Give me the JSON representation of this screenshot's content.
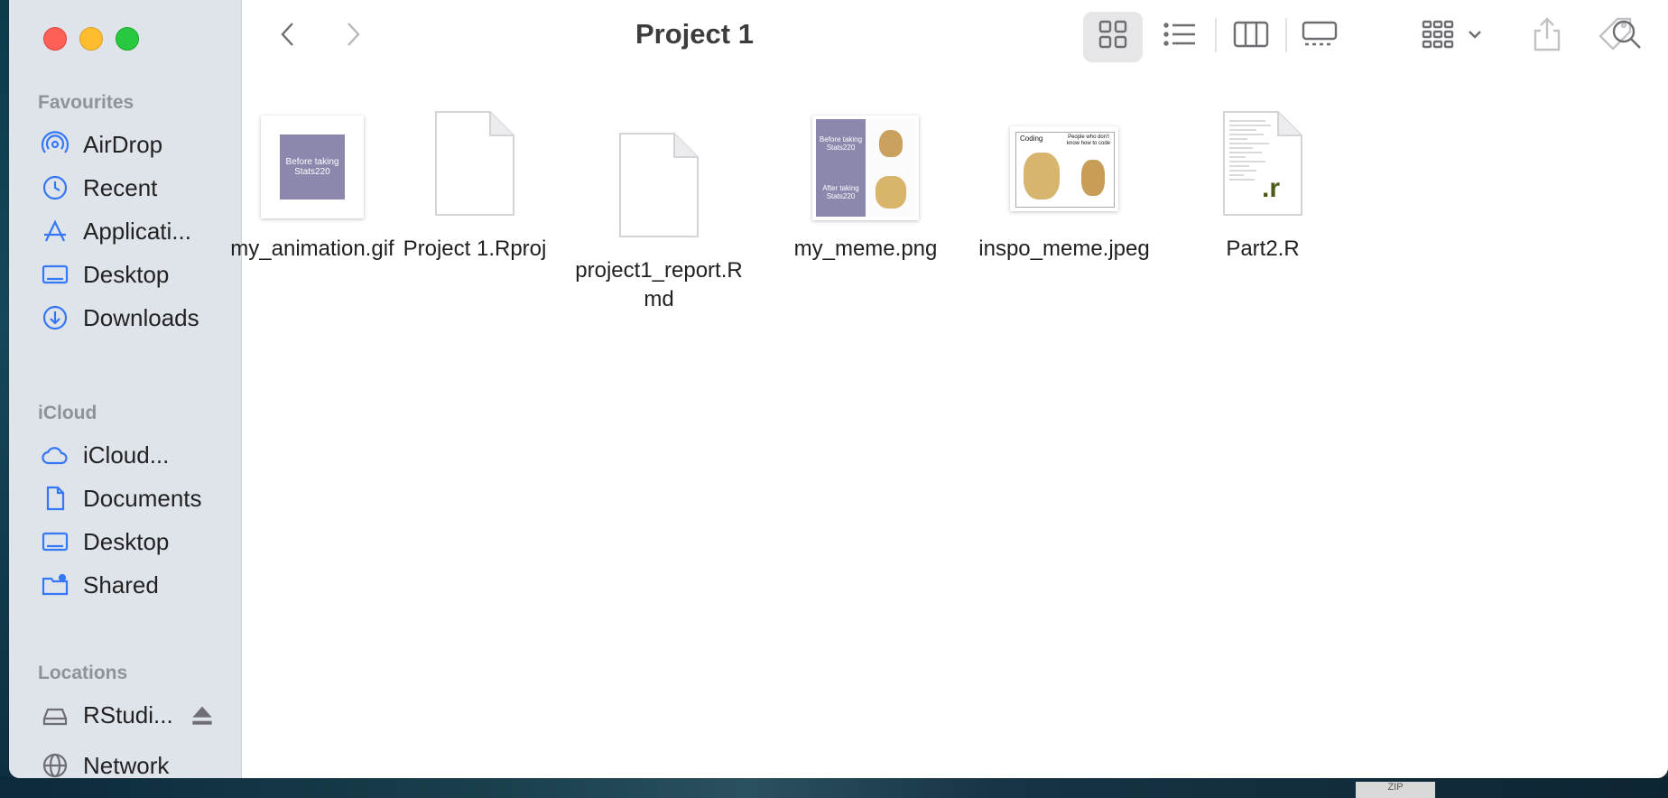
{
  "window": {
    "title": "Project 1"
  },
  "sidebar": {
    "sections": [
      {
        "title": "Favourites",
        "items": [
          {
            "label": "AirDrop",
            "icon": "airdrop-icon"
          },
          {
            "label": "Recent",
            "icon": "clock-icon"
          },
          {
            "label": "Applicati...",
            "icon": "applications-icon"
          },
          {
            "label": "Desktop",
            "icon": "desktop-icon"
          },
          {
            "label": "Downloads",
            "icon": "download-icon"
          }
        ]
      },
      {
        "title": "iCloud",
        "items": [
          {
            "label": "iCloud...",
            "icon": "cloud-icon"
          },
          {
            "label": "Documents",
            "icon": "document-icon"
          },
          {
            "label": "Desktop",
            "icon": "desktop-icon"
          },
          {
            "label": "Shared",
            "icon": "shared-folder-icon"
          }
        ]
      },
      {
        "title": "Locations",
        "items": [
          {
            "label": "RStudi...",
            "icon": "disk-icon"
          },
          {
            "label": "Network",
            "icon": "network-icon"
          }
        ]
      }
    ]
  },
  "toolbar": {
    "back": "chevron-left-icon",
    "forward": "chevron-right-icon",
    "views": [
      "icon-view-icon",
      "list-view-icon",
      "column-view-icon",
      "gallery-view-icon"
    ],
    "group": "group-icon",
    "share": "share-icon",
    "tag": "tag-icon",
    "more": "more-icon",
    "search": "search-icon"
  },
  "files": [
    {
      "name": "my_animation.gif",
      "thumb_text": "Before taking Stats220"
    },
    {
      "name": "Project 1.Rproj"
    },
    {
      "name": "project1_report.R",
      "name_line2": "md"
    },
    {
      "name": "my_meme.png",
      "thumb_top": "Before taking Stats220",
      "thumb_bottom": "After taking Stats220"
    },
    {
      "name": "inspo_meme.jpeg",
      "thumb_left": "Coding",
      "thumb_right": "People who don't know how to code"
    },
    {
      "name": "Part2.R",
      "badge": ".r"
    }
  ],
  "desktop": {
    "zip_label": "ZIP"
  },
  "colors": {
    "sidebar_bg": "#dfe3ea",
    "accent": "#3478f6",
    "thumb_purple": "#8b87ad"
  }
}
